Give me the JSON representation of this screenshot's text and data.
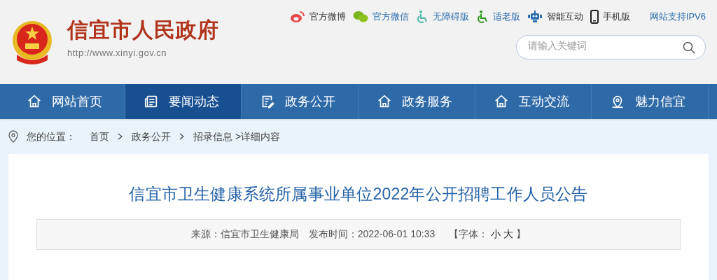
{
  "header": {
    "site_title": "信宜市人民政府",
    "url": "http://www.xinyi.gov.cn"
  },
  "top_links": [
    {
      "kind": "weibo",
      "label": "官方微博",
      "color": "#333333"
    },
    {
      "kind": "wechat",
      "label": "官方微信",
      "color": "#2a6db0"
    },
    {
      "kind": "accessibility",
      "label": "无障碍版",
      "color": "#2a6db0"
    },
    {
      "kind": "elderly",
      "label": "适老版",
      "color": "#2a6db0"
    },
    {
      "kind": "robot",
      "label": "智能互动",
      "color": "#333333"
    },
    {
      "kind": "mobile",
      "label": "手机版",
      "color": "#333333"
    },
    {
      "kind": "none",
      "label": "网站支持IPV6",
      "color": "#2a6db0"
    }
  ],
  "search": {
    "placeholder": "请输入关键词"
  },
  "nav": [
    {
      "label": "网站首页",
      "kind": "home",
      "selected": false
    },
    {
      "label": "要闻动态",
      "kind": "news",
      "selected": true
    },
    {
      "label": "政务公开",
      "kind": "document",
      "selected": false
    },
    {
      "label": "政务服务",
      "kind": "home",
      "selected": false
    },
    {
      "label": "互动交流",
      "kind": "home",
      "selected": false
    },
    {
      "label": "魅力信宜",
      "kind": "pin",
      "selected": false
    }
  ],
  "breadcrumb": {
    "prefix": "您的位置：",
    "items": [
      "首页",
      "政务公开",
      "招录信息"
    ],
    "current": ">详细内容"
  },
  "article": {
    "title": "信宜市卫生健康系统所属事业单位2022年公开招聘工作人员公告",
    "source": "来源：信宜市卫生健康局",
    "published": "发布时间：2022-06-01 10:33",
    "font_label": "【字体：",
    "font_small": "小",
    "font_large": "大",
    "font_close": "】"
  }
}
